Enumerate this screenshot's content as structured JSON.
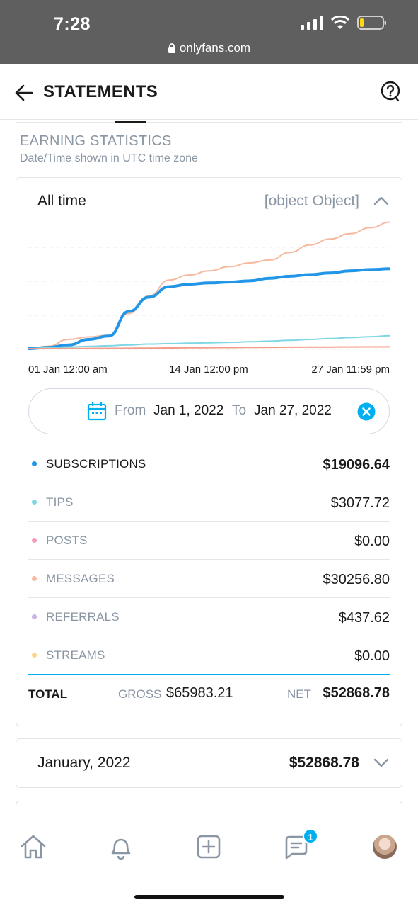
{
  "status": {
    "time": "7:28",
    "url": "onlyfans.com"
  },
  "header": {
    "title": "STATEMENTS"
  },
  "section": {
    "title": "EARNING STATISTICS",
    "subtitle": "Date/Time shown in UTC time zone"
  },
  "card": {
    "label": "All time",
    "total": {
      "label": "TOTAL",
      "gross_label": "GROSS",
      "gross_value": "$65983.21",
      "net_label": "NET",
      "net_value": "$52868.78"
    },
    "date_range": {
      "from_label": "From",
      "from_value": "Jan 1, 2022",
      "to_label": "To",
      "to_value": "Jan 27, 2022"
    },
    "rows": [
      {
        "label": "SUBSCRIPTIONS",
        "value": "$19096.64",
        "color": "#2196e6"
      },
      {
        "label": "TIPS",
        "value": "$3077.72",
        "color": "#7fd6e4"
      },
      {
        "label": "POSTS",
        "value": "$0.00",
        "color": "#f39bb7"
      },
      {
        "label": "MESSAGES",
        "value": "$30256.80",
        "color": "#f6b9a0"
      },
      {
        "label": "REFERRALS",
        "value": "$437.62",
        "color": "#c9b6e2"
      },
      {
        "label": "STREAMS",
        "value": "$0.00",
        "color": "#f9d48a"
      }
    ]
  },
  "month_card": {
    "label": "January, 2022",
    "value": "$52868.78"
  },
  "nav": {
    "messages_badge": "1"
  },
  "chart_data": {
    "type": "line",
    "x": [
      "01 Jan 12:00 am",
      "14 Jan 12:00 pm",
      "27 Jan 11:59 pm"
    ],
    "x_ticks": [
      "01 Jan 12:00 am",
      "14 Jan 12:00 pm",
      "27 Jan 11:59 pm"
    ],
    "grid": true,
    "series": [
      {
        "name": "MESSAGES",
        "color": "#f6b9a0",
        "values": [
          0,
          600,
          2200,
          2800,
          3200,
          8400,
          12600,
          16400,
          17600,
          18600,
          19600,
          20500,
          21200,
          23000,
          24800,
          26200,
          27500,
          28900,
          30256.8
        ]
      },
      {
        "name": "SUBSCRIPTIONS",
        "color": "#2196e6",
        "values": [
          0,
          300,
          900,
          2200,
          3000,
          8900,
          12300,
          14800,
          15400,
          15700,
          15900,
          16200,
          16800,
          17300,
          17700,
          18100,
          18600,
          18900,
          19096.64
        ]
      },
      {
        "name": "TIPS",
        "color": "#7fd6e4",
        "values": [
          0,
          200,
          400,
          550,
          700,
          900,
          1100,
          1200,
          1300,
          1400,
          1500,
          1650,
          1800,
          2000,
          2200,
          2400,
          2650,
          2850,
          3077.72
        ]
      },
      {
        "name": "REFERRALS",
        "color": "#f39b8a",
        "values": [
          0,
          20,
          40,
          60,
          80,
          110,
          140,
          170,
          200,
          230,
          260,
          290,
          320,
          350,
          370,
          390,
          410,
          425,
          437.62
        ]
      }
    ]
  }
}
